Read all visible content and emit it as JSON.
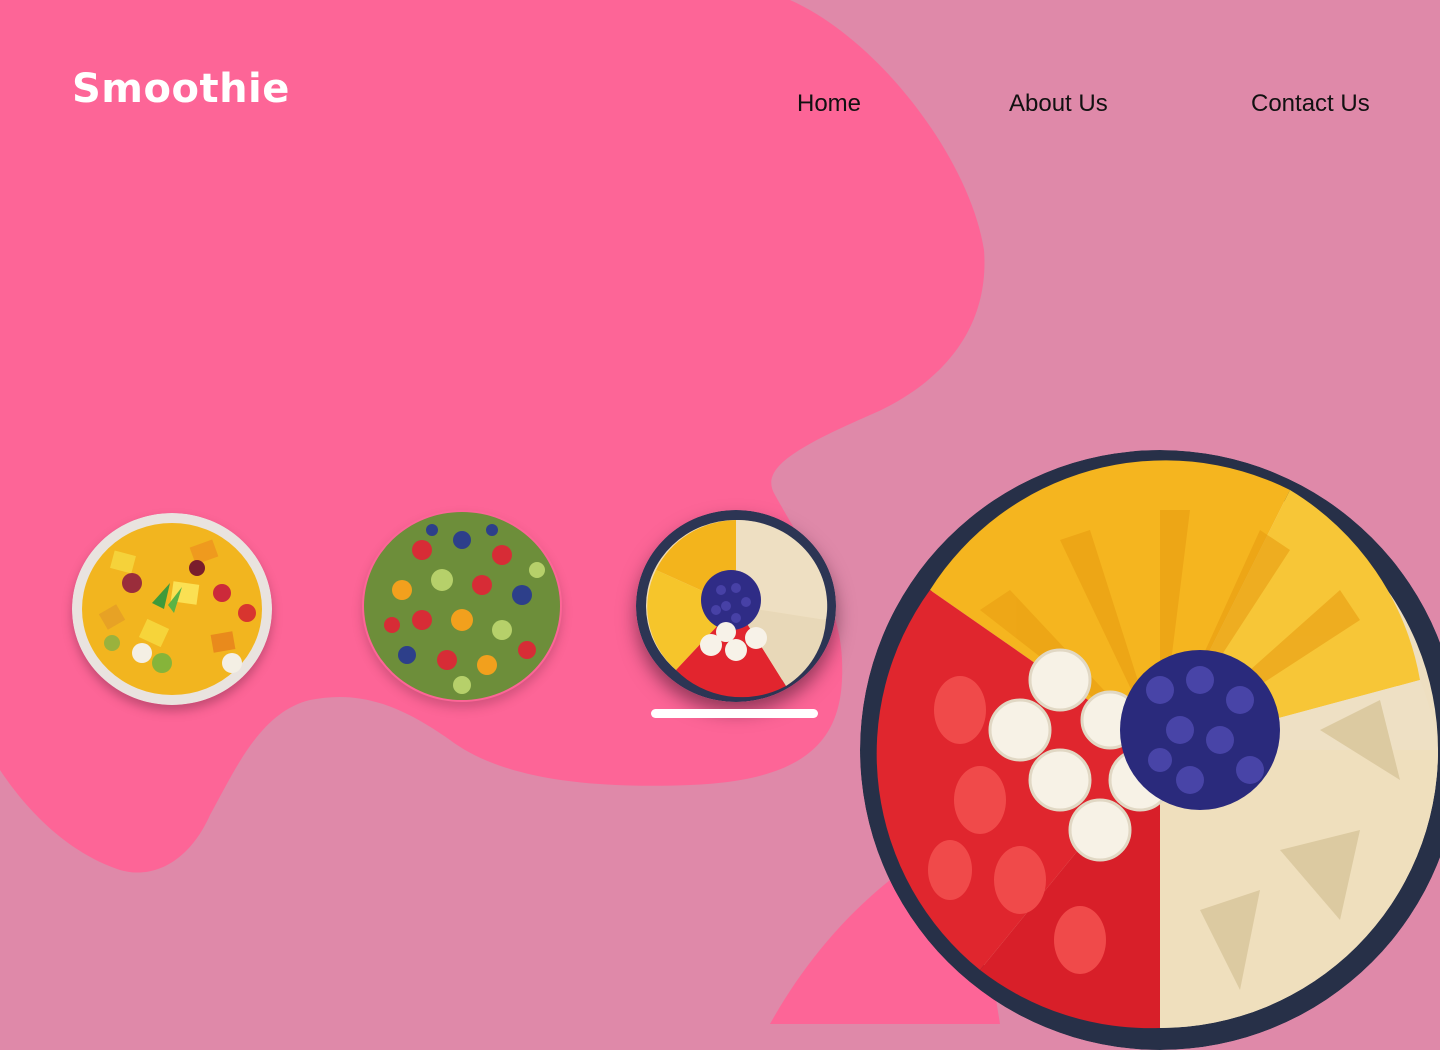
{
  "brand": {
    "name": "Smoothie"
  },
  "nav": {
    "items": [
      {
        "label": "Home"
      },
      {
        "label": "About Us"
      },
      {
        "label": "Contact Us"
      }
    ]
  },
  "carousel": {
    "selected_index": 2,
    "items": [
      {
        "image": "fruit-salad-bowl"
      },
      {
        "image": "mixed-berry-platter"
      },
      {
        "image": "fruit-plate-mango-banana-blueberry"
      }
    ]
  },
  "hero": {
    "image": "fruit-plate-mango-banana-blueberry"
  },
  "colors": {
    "background": "#df89a9",
    "blob": "#fd6597",
    "brand_text": "#ffffff",
    "nav_text": "#111111",
    "indicator": "#ffffff"
  }
}
